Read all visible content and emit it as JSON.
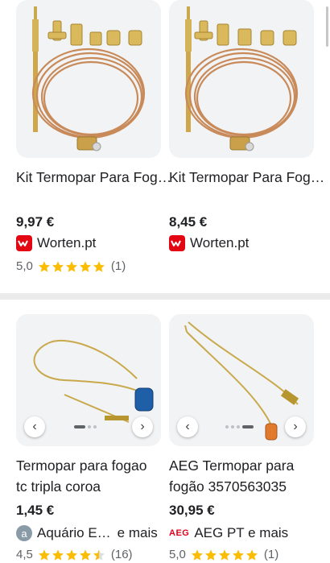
{
  "products": [
    {
      "title": "Kit Termopar Para Fogão A Gás Sond…",
      "price": "9,97 €",
      "seller": "Worten.pt",
      "seller_color": "#e30613",
      "rating_value": "5,0",
      "rating_stars": 5,
      "review_count": "(1)"
    },
    {
      "title": "Kit Termopar Para Fogão A Gás",
      "price": "8,45 €",
      "seller": "Worten.pt",
      "seller_color": "#e30613",
      "rating_value": null,
      "rating_stars": null,
      "review_count": null
    },
    {
      "title": "Termopar para fogao tc tripla coroa",
      "price": "1,45 €",
      "seller": "Aquário E…",
      "seller_more": "e mais",
      "seller_color": "#8a9ba8",
      "rating_value": "4,5",
      "rating_stars": 4.5,
      "review_count": "(16)"
    },
    {
      "title": "AEG Termopar para fogão 3570563035",
      "price": "30,95 €",
      "seller": "AEG PT e mais",
      "seller_logo_text": "AEG",
      "seller_color": "#e2001a",
      "rating_value": "5,0",
      "rating_stars": 5,
      "review_count": "(1)"
    }
  ],
  "icons": {
    "prev": "chevron-left-icon",
    "next": "chevron-right-icon",
    "star": "star-icon"
  },
  "colors": {
    "star": "#fbbc04",
    "card_bg": "#f1f3f4"
  }
}
